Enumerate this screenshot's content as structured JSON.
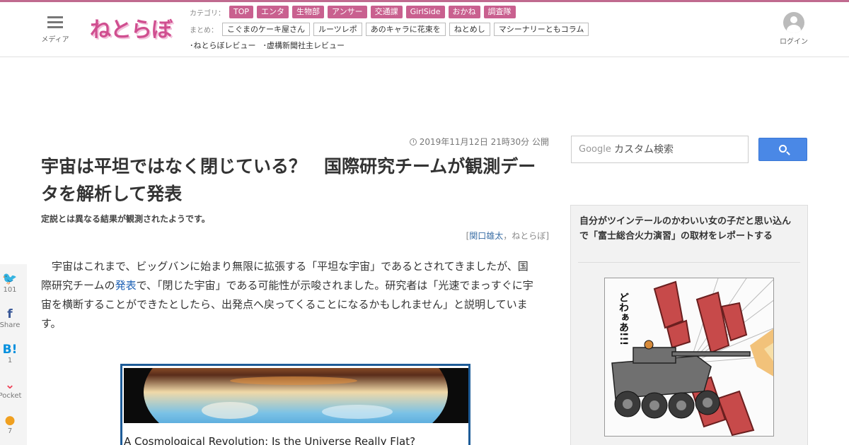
{
  "header": {
    "menu_label": "メディア",
    "logo_text": "ねとらぼ",
    "category_label": "カテゴリ：",
    "categories": [
      "TOP",
      "エンタ",
      "生物部",
      "アンサー",
      "交通課",
      "GirlSide",
      "おかね",
      "調査隊"
    ],
    "summary_label": "まとめ：",
    "summaries": [
      "こぐまのケーキ屋さん",
      "ルーツレポ",
      "あのキャラに花束を",
      "ねとめし",
      "マシーナリーともコラム"
    ],
    "reviews": [
      "･ねとらぼレビュー",
      "･虚構新聞社主レビュー"
    ],
    "login_label": "ログイン"
  },
  "article": {
    "published": "2019年11月12日 21時30分 公開",
    "title": "宇宙は平坦ではなく閉じている？　国際研究チームが観測データを解析して発表",
    "subtitle": "定説とは異なる結果が観測されたようです。",
    "byline_open": "[",
    "author": "関口雄太",
    "byline_sep": "，",
    "byline_outlet": "ねとらぼ",
    "byline_close": "]",
    "body_part1": "宇宙はこれまで、ビッグバンに始まり無限に拡張する「平坦な宇宙」であるとされてきましたが、国際研究チームの",
    "body_link": "発表",
    "body_part2": "で、「閉じた宇宙」である可能性が示唆されました。研究者は「光速でまっすぐに宇宙を横断することができたとしたら、出発点へ戻ってくることになるかもしれません」と説明しています。",
    "embed_caption": "A Cosmological Revolution: Is the Universe Really Flat?"
  },
  "share": [
    {
      "icon": "twitter-icon",
      "glyph": "🐦",
      "count": "101",
      "color": "#1da1f2"
    },
    {
      "icon": "facebook-icon",
      "glyph": "f",
      "count": "Share",
      "color": "#3b5998"
    },
    {
      "icon": "hatena-icon",
      "glyph": "B!",
      "count": "1",
      "color": "#008fde"
    },
    {
      "icon": "pocket-icon",
      "glyph": "⌄",
      "count": "Pocket",
      "color": "#ef4056"
    },
    {
      "icon": "comment-icon",
      "glyph": "●",
      "count": "7",
      "color": "#f0a020"
    }
  ],
  "sidebar": {
    "google_label": "Google",
    "search_placeholder": "カスタム検索",
    "feature_title": "自分がツインテールのかわいい女の子だと思い込んで「富士総合火力演習」の取材をレポートする",
    "manga_sfx": "どわぁあ!!!"
  }
}
